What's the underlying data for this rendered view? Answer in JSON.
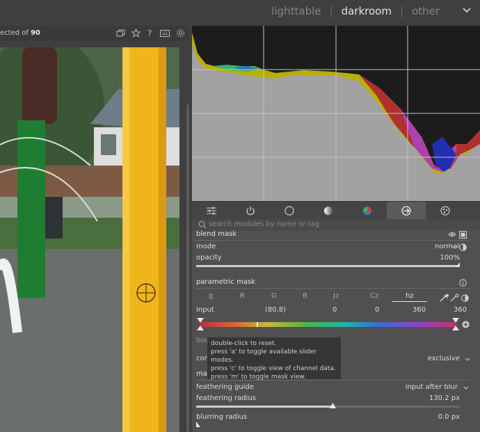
{
  "header": {
    "views": [
      "lighttable",
      "darkroom",
      "other"
    ],
    "active_view": "darkroom",
    "separator": "|"
  },
  "filmstrip": {
    "selected_prefix": "ected of ",
    "selected_count": "90"
  },
  "tabs": [
    "quick-access",
    "active-modules",
    "base",
    "tone",
    "color",
    "correct",
    "effect"
  ],
  "search": {
    "placeholder": "search modules by name or tag"
  },
  "blend": {
    "title": "blend mask",
    "mode_label": "mode",
    "mode_value": "normal",
    "opacity_label": "opacity",
    "opacity_value": "100%",
    "opacity_fraction": 1.0
  },
  "parametric": {
    "title": "parametric mask",
    "channels": [
      "g",
      "R",
      "G",
      "B",
      "Jz",
      "Cz",
      "hz"
    ],
    "active_channel": "hz",
    "input_label": "input",
    "input_values": [
      "(80.8)",
      "0",
      "0",
      "360",
      "360"
    ]
  },
  "tooltip": {
    "lines": [
      "double-click to reset.",
      "press 'a' to toggle available slider modes.",
      "press 'c' to toggle view of channel data.",
      "press 'm' to toggle mask view."
    ]
  },
  "hidden_labels": {
    "boost": "boo",
    "combine": "com",
    "combine_value": "exclusive",
    "mask_refine": "mas"
  },
  "refine": {
    "guide_label": "feathering guide",
    "guide_value": "input after blur",
    "radius_label": "feathering radius",
    "radius_value": "130.2 px",
    "radius_fraction": 0.52,
    "blur_label": "blurring radius",
    "blur_value": "0.0 px"
  }
}
